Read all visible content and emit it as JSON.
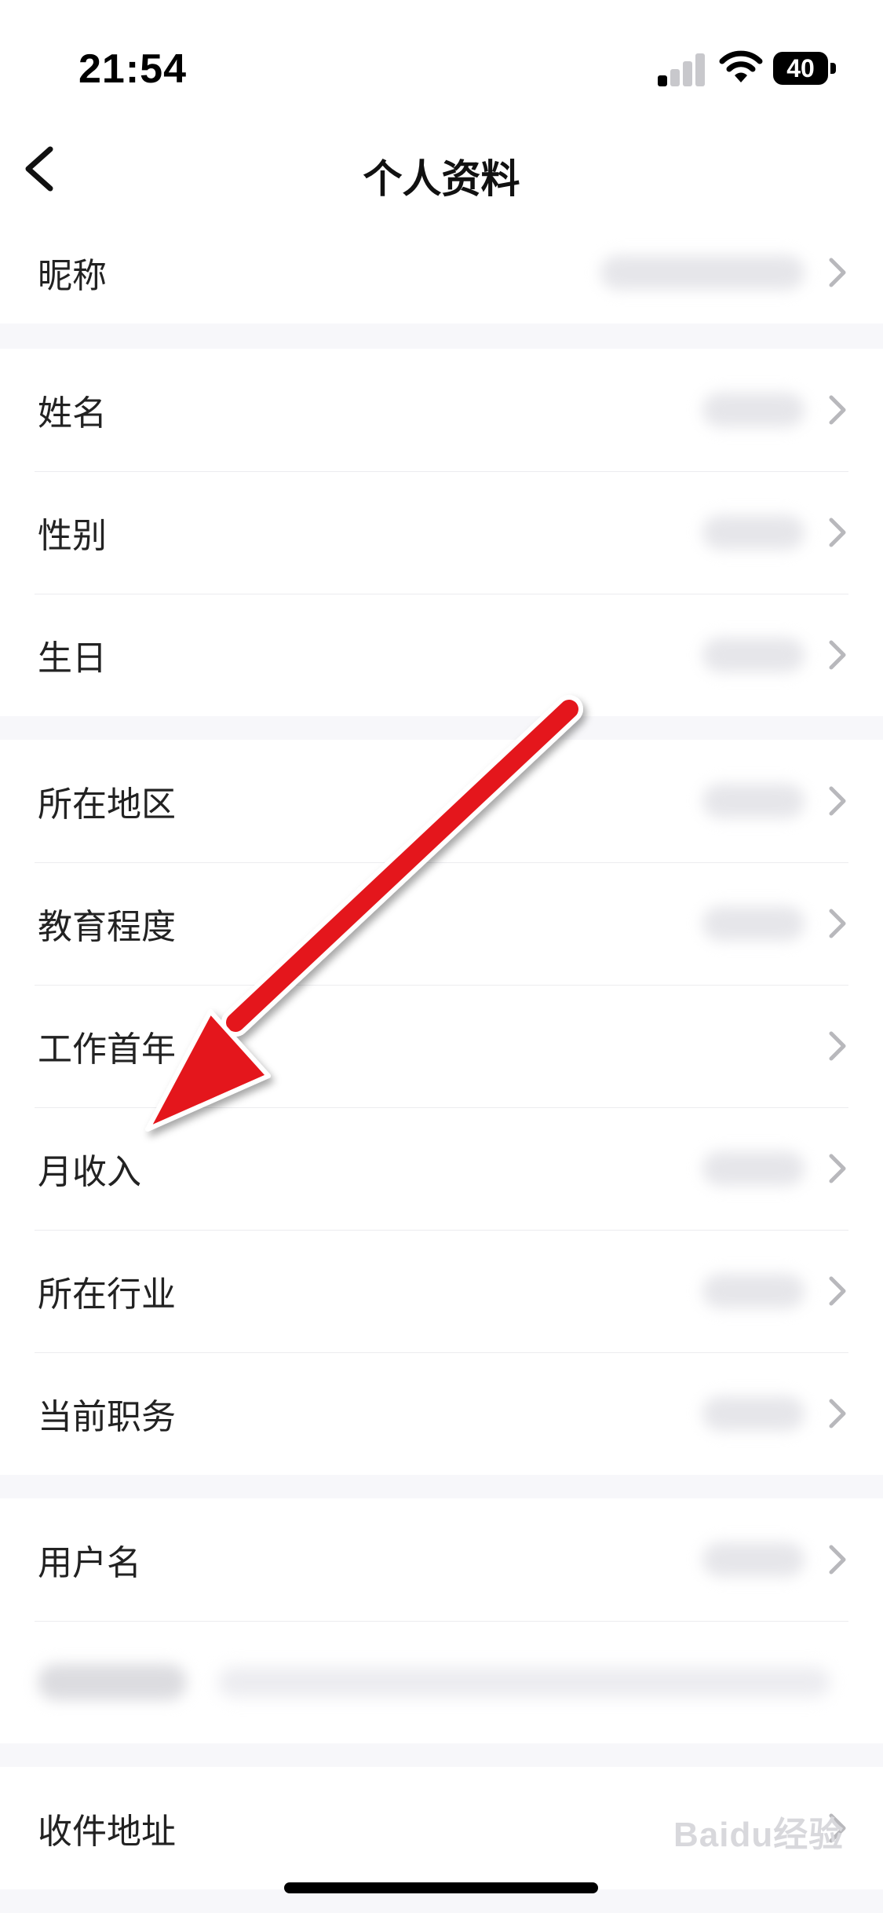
{
  "status_bar": {
    "time": "21:54",
    "battery": "40"
  },
  "nav": {
    "title": "个人资料"
  },
  "groups": [
    {
      "items": [
        {
          "label": "昵称"
        }
      ]
    },
    {
      "items": [
        {
          "label": "姓名"
        },
        {
          "label": "性别"
        },
        {
          "label": "生日"
        }
      ]
    },
    {
      "items": [
        {
          "label": "所在地区"
        },
        {
          "label": "教育程度"
        },
        {
          "label": "工作首年"
        },
        {
          "label": "月收入"
        },
        {
          "label": "所在行业"
        },
        {
          "label": "当前职务"
        }
      ]
    },
    {
      "items": [
        {
          "label": "用户名"
        }
      ]
    },
    {
      "items": [
        {
          "label": "收件地址"
        }
      ]
    }
  ],
  "watermark": {
    "text": "Baidu经验"
  },
  "annotation": {
    "color": "#e4161b"
  }
}
